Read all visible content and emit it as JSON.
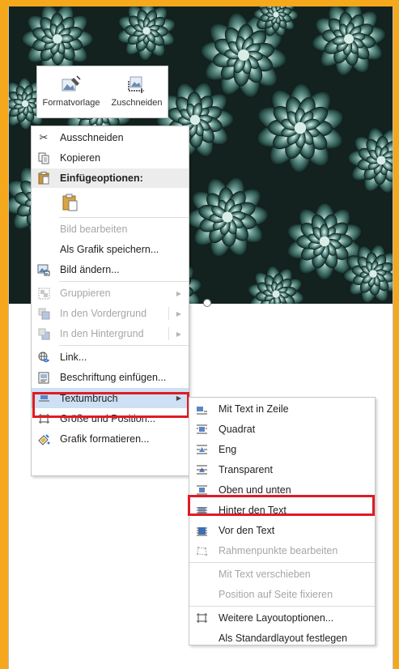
{
  "mini_toolbar": {
    "style_label": "Formatvorlage",
    "crop_label": "Zuschneiden"
  },
  "context_menu": {
    "cut": "Ausschneiden",
    "copy": "Kopieren",
    "paste_header": "Einfügeoptionen:",
    "edit_picture": "Bild bearbeiten",
    "save_as_picture": "Als Grafik speichern...",
    "change_picture": "Bild ändern...",
    "group": "Gruppieren",
    "bring_forward": "In den Vordergrund",
    "send_backward": "In den Hintergrund",
    "link": "Link...",
    "insert_caption": "Beschriftung einfügen...",
    "wrap_text": "Textumbruch",
    "size_position": "Größe und Position...",
    "format_picture": "Grafik formatieren..."
  },
  "wrap_submenu": {
    "inline": "Mit Text in Zeile",
    "square": "Quadrat",
    "tight": "Eng",
    "through": "Transparent",
    "top_bottom": "Oben und unten",
    "behind_text": "Hinter den Text",
    "in_front": "Vor den Text",
    "edit_wrap_points": "Rahmenpunkte bearbeiten",
    "move_with_text": "Mit Text verschieben",
    "fix_position": "Position auf Seite fixieren",
    "more_layout": "Weitere Layoutoptionen...",
    "set_default": "Als Standardlayout festlegen"
  },
  "colors": {
    "highlight_box": "#e01b24",
    "hover": "#cde0f4",
    "page_border": "#f5a81c"
  }
}
